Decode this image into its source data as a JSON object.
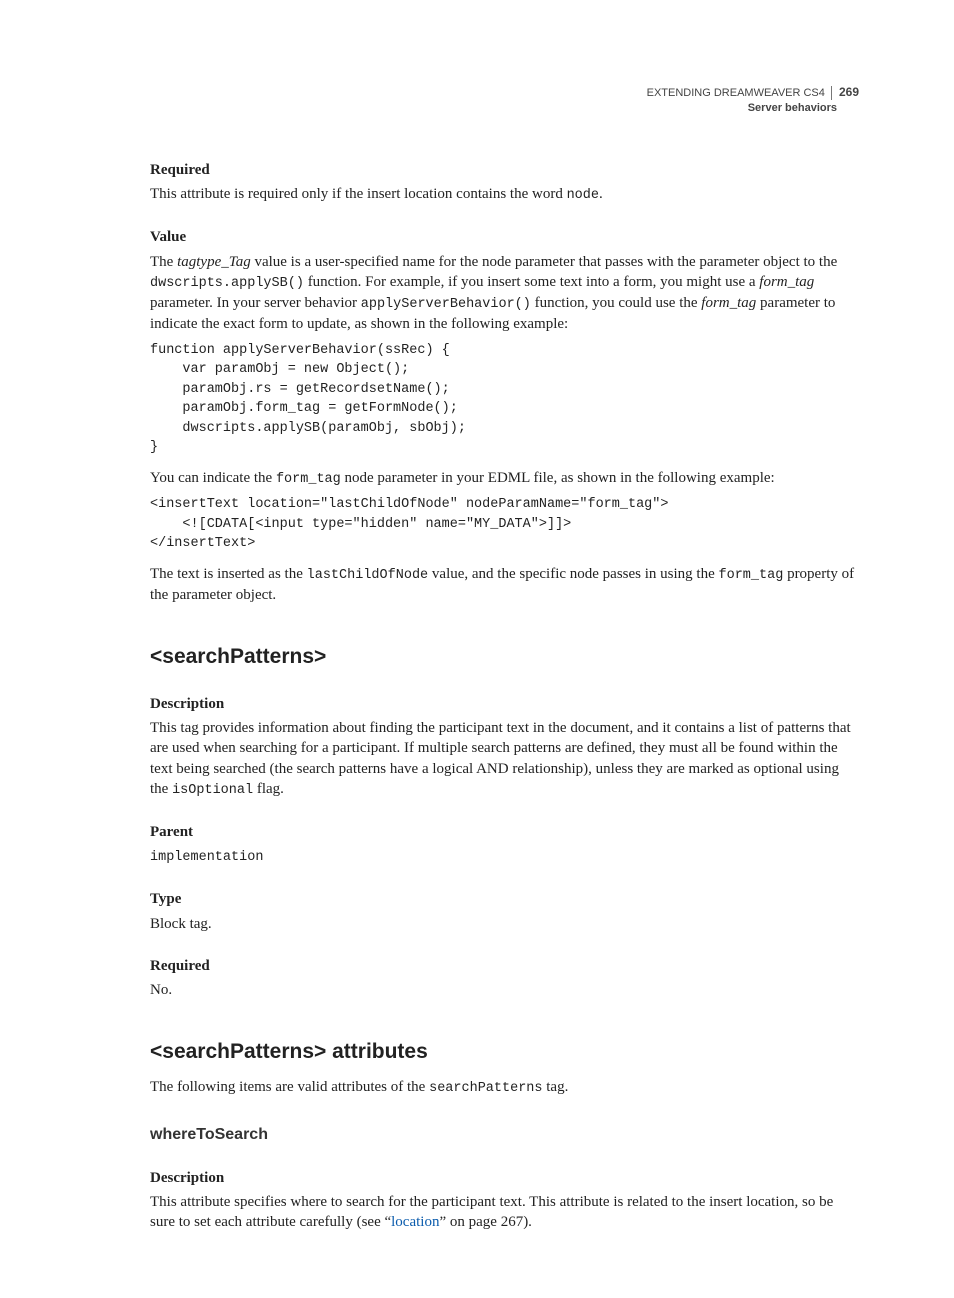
{
  "header": {
    "book_title": "EXTENDING DREAMWEAVER CS4",
    "section": "Server behaviors",
    "page_number": "269"
  },
  "required1": {
    "heading": "Required",
    "p_pre": "This attribute is required only if the insert location contains the word ",
    "p_code": "node",
    "p_post": "."
  },
  "value": {
    "heading": "Value",
    "p1_a": "The ",
    "p1_ital1": "tagtype_Tag",
    "p1_b": " value is a user-specified name for the node parameter that passes with the parameter object to the ",
    "p1_code1": "dwscripts.applySB()",
    "p1_c": " function. For example, if you insert some text into a form, you might use a ",
    "p1_ital2": "form_tag",
    "p1_d": " parameter. In your server behavior ",
    "p1_code2": "applyServerBehavior()",
    "p1_e": " function, you could use the ",
    "p1_ital3": "form_tag",
    "p1_f": " parameter to indicate the exact form to update, as shown in the following example:",
    "code1": "function applyServerBehavior(ssRec) {\n    var paramObj = new Object();\n    paramObj.rs = getRecordsetName();\n    paramObj.form_tag = getFormNode();\n    dwscripts.applySB(paramObj, sbObj);\n}",
    "p2_a": "You can indicate the ",
    "p2_code": "form_tag",
    "p2_b": " node parameter in your EDML file, as shown in the following example:",
    "code2": "<insertText location=\"lastChildOfNode\" nodeParamName=\"form_tag\">\n    <![CDATA[<input type=\"hidden\" name=\"MY_DATA\">]]>\n</insertText>",
    "p3_a": "The text is inserted as the ",
    "p3_code1": "lastChildOfNode",
    "p3_b": " value, and the specific node passes in using the ",
    "p3_code2": "form_tag",
    "p3_c": " property of the parameter object."
  },
  "searchPatterns": {
    "heading": "<searchPatterns>",
    "desc_heading": "Description",
    "desc_a": "This tag provides information about finding the participant text in the document, and it contains a list of patterns that are used when searching for a participant. If multiple search patterns are defined, they must all be found within the text being searched (the search patterns have a logical AND relationship), unless they are marked as optional using the ",
    "desc_code": "isOptional",
    "desc_b": " flag.",
    "parent_heading": "Parent",
    "parent_code": "implementation",
    "type_heading": "Type",
    "type_text": "Block tag.",
    "required_heading": "Required",
    "required_text": "No."
  },
  "attributes": {
    "heading": "<searchPatterns> attributes",
    "intro_a": "The following items are valid attributes of the ",
    "intro_code": "searchPatterns",
    "intro_b": " tag.",
    "where_heading": "whereToSearch",
    "where_desc_heading": "Description",
    "where_desc_a": "This attribute specifies where to search for the participant text. This attribute is related to the insert location, so be sure to set each attribute carefully (see “",
    "where_desc_link": "location",
    "where_desc_b": "” on page 267)."
  }
}
